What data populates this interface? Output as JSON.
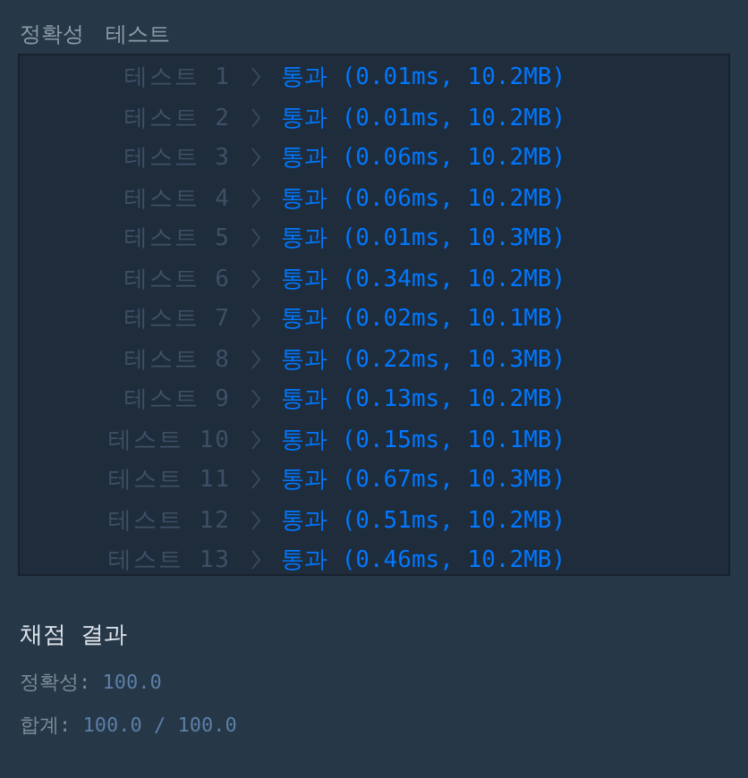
{
  "tabs": [
    {
      "label": "정확성"
    },
    {
      "label": "테스트"
    }
  ],
  "tests": [
    {
      "label": "테스트 1",
      "kind": "pass",
      "result": "통과",
      "detail": "(0.01ms, 10.2MB)"
    },
    {
      "label": "테스트 2",
      "kind": "pass",
      "result": "통과",
      "detail": "(0.01ms, 10.2MB)"
    },
    {
      "label": "테스트 3",
      "kind": "pass",
      "result": "통과",
      "detail": "(0.06ms, 10.2MB)"
    },
    {
      "label": "테스트 4",
      "kind": "pass",
      "result": "통과",
      "detail": "(0.06ms, 10.2MB)"
    },
    {
      "label": "테스트 5",
      "kind": "pass",
      "result": "통과",
      "detail": "(0.01ms, 10.3MB)"
    },
    {
      "label": "테스트 6",
      "kind": "pass",
      "result": "통과",
      "detail": "(0.34ms, 10.2MB)"
    },
    {
      "label": "테스트 7",
      "kind": "pass",
      "result": "통과",
      "detail": "(0.02ms, 10.1MB)"
    },
    {
      "label": "테스트 8",
      "kind": "pass",
      "result": "통과",
      "detail": "(0.22ms, 10.3MB)"
    },
    {
      "label": "테스트 9",
      "kind": "pass",
      "result": "통과",
      "detail": "(0.13ms, 10.2MB)"
    },
    {
      "label": "테스트 10",
      "kind": "pass",
      "result": "통과",
      "detail": "(0.15ms, 10.1MB)"
    },
    {
      "label": "테스트 11",
      "kind": "pass",
      "result": "통과",
      "detail": "(0.67ms, 10.3MB)"
    },
    {
      "label": "테스트 12",
      "kind": "pass",
      "result": "통과",
      "detail": "(0.51ms, 10.2MB)"
    },
    {
      "label": "테스트 13",
      "kind": "pass",
      "result": "통과",
      "detail": "(0.46ms, 10.2MB)"
    }
  ],
  "summary": {
    "title": "채점 결과",
    "lines": [
      {
        "label": "정확성:",
        "value": "100.0"
      },
      {
        "label": "합계:",
        "value": "100.0 / 100.0"
      }
    ]
  }
}
